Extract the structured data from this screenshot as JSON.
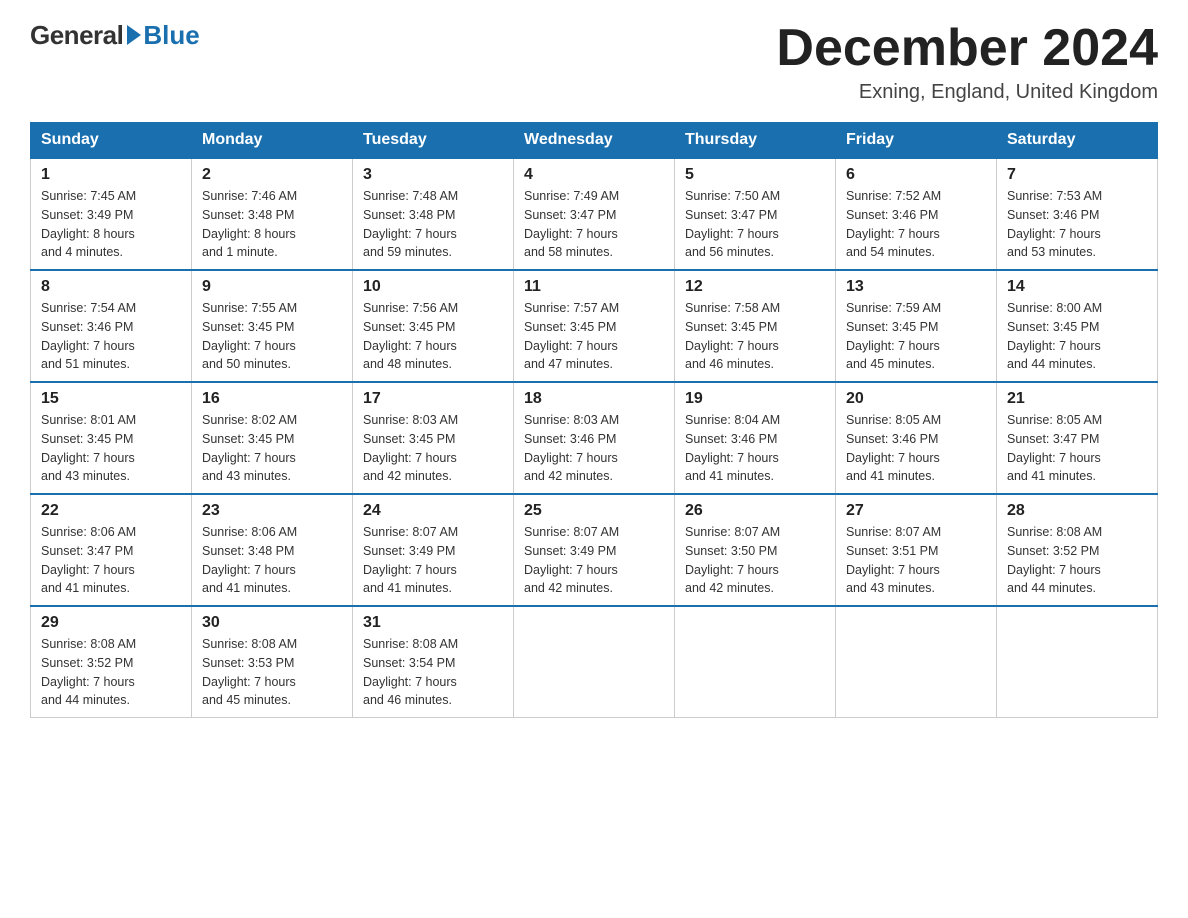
{
  "logo": {
    "general": "General",
    "blue": "Blue",
    "sub": ""
  },
  "header": {
    "month_title": "December 2024",
    "location": "Exning, England, United Kingdom"
  },
  "weekdays": [
    "Sunday",
    "Monday",
    "Tuesday",
    "Wednesday",
    "Thursday",
    "Friday",
    "Saturday"
  ],
  "weeks": [
    [
      {
        "day": "1",
        "sunrise": "7:45 AM",
        "sunset": "3:49 PM",
        "daylight": "8 hours and 4 minutes."
      },
      {
        "day": "2",
        "sunrise": "7:46 AM",
        "sunset": "3:48 PM",
        "daylight": "8 hours and 1 minute."
      },
      {
        "day": "3",
        "sunrise": "7:48 AM",
        "sunset": "3:48 PM",
        "daylight": "7 hours and 59 minutes."
      },
      {
        "day": "4",
        "sunrise": "7:49 AM",
        "sunset": "3:47 PM",
        "daylight": "7 hours and 58 minutes."
      },
      {
        "day": "5",
        "sunrise": "7:50 AM",
        "sunset": "3:47 PM",
        "daylight": "7 hours and 56 minutes."
      },
      {
        "day": "6",
        "sunrise": "7:52 AM",
        "sunset": "3:46 PM",
        "daylight": "7 hours and 54 minutes."
      },
      {
        "day": "7",
        "sunrise": "7:53 AM",
        "sunset": "3:46 PM",
        "daylight": "7 hours and 53 minutes."
      }
    ],
    [
      {
        "day": "8",
        "sunrise": "7:54 AM",
        "sunset": "3:46 PM",
        "daylight": "7 hours and 51 minutes."
      },
      {
        "day": "9",
        "sunrise": "7:55 AM",
        "sunset": "3:45 PM",
        "daylight": "7 hours and 50 minutes."
      },
      {
        "day": "10",
        "sunrise": "7:56 AM",
        "sunset": "3:45 PM",
        "daylight": "7 hours and 48 minutes."
      },
      {
        "day": "11",
        "sunrise": "7:57 AM",
        "sunset": "3:45 PM",
        "daylight": "7 hours and 47 minutes."
      },
      {
        "day": "12",
        "sunrise": "7:58 AM",
        "sunset": "3:45 PM",
        "daylight": "7 hours and 46 minutes."
      },
      {
        "day": "13",
        "sunrise": "7:59 AM",
        "sunset": "3:45 PM",
        "daylight": "7 hours and 45 minutes."
      },
      {
        "day": "14",
        "sunrise": "8:00 AM",
        "sunset": "3:45 PM",
        "daylight": "7 hours and 44 minutes."
      }
    ],
    [
      {
        "day": "15",
        "sunrise": "8:01 AM",
        "sunset": "3:45 PM",
        "daylight": "7 hours and 43 minutes."
      },
      {
        "day": "16",
        "sunrise": "8:02 AM",
        "sunset": "3:45 PM",
        "daylight": "7 hours and 43 minutes."
      },
      {
        "day": "17",
        "sunrise": "8:03 AM",
        "sunset": "3:45 PM",
        "daylight": "7 hours and 42 minutes."
      },
      {
        "day": "18",
        "sunrise": "8:03 AM",
        "sunset": "3:46 PM",
        "daylight": "7 hours and 42 minutes."
      },
      {
        "day": "19",
        "sunrise": "8:04 AM",
        "sunset": "3:46 PM",
        "daylight": "7 hours and 41 minutes."
      },
      {
        "day": "20",
        "sunrise": "8:05 AM",
        "sunset": "3:46 PM",
        "daylight": "7 hours and 41 minutes."
      },
      {
        "day": "21",
        "sunrise": "8:05 AM",
        "sunset": "3:47 PM",
        "daylight": "7 hours and 41 minutes."
      }
    ],
    [
      {
        "day": "22",
        "sunrise": "8:06 AM",
        "sunset": "3:47 PM",
        "daylight": "7 hours and 41 minutes."
      },
      {
        "day": "23",
        "sunrise": "8:06 AM",
        "sunset": "3:48 PM",
        "daylight": "7 hours and 41 minutes."
      },
      {
        "day": "24",
        "sunrise": "8:07 AM",
        "sunset": "3:49 PM",
        "daylight": "7 hours and 41 minutes."
      },
      {
        "day": "25",
        "sunrise": "8:07 AM",
        "sunset": "3:49 PM",
        "daylight": "7 hours and 42 minutes."
      },
      {
        "day": "26",
        "sunrise": "8:07 AM",
        "sunset": "3:50 PM",
        "daylight": "7 hours and 42 minutes."
      },
      {
        "day": "27",
        "sunrise": "8:07 AM",
        "sunset": "3:51 PM",
        "daylight": "7 hours and 43 minutes."
      },
      {
        "day": "28",
        "sunrise": "8:08 AM",
        "sunset": "3:52 PM",
        "daylight": "7 hours and 44 minutes."
      }
    ],
    [
      {
        "day": "29",
        "sunrise": "8:08 AM",
        "sunset": "3:52 PM",
        "daylight": "7 hours and 44 minutes."
      },
      {
        "day": "30",
        "sunrise": "8:08 AM",
        "sunset": "3:53 PM",
        "daylight": "7 hours and 45 minutes."
      },
      {
        "day": "31",
        "sunrise": "8:08 AM",
        "sunset": "3:54 PM",
        "daylight": "7 hours and 46 minutes."
      },
      null,
      null,
      null,
      null
    ]
  ]
}
